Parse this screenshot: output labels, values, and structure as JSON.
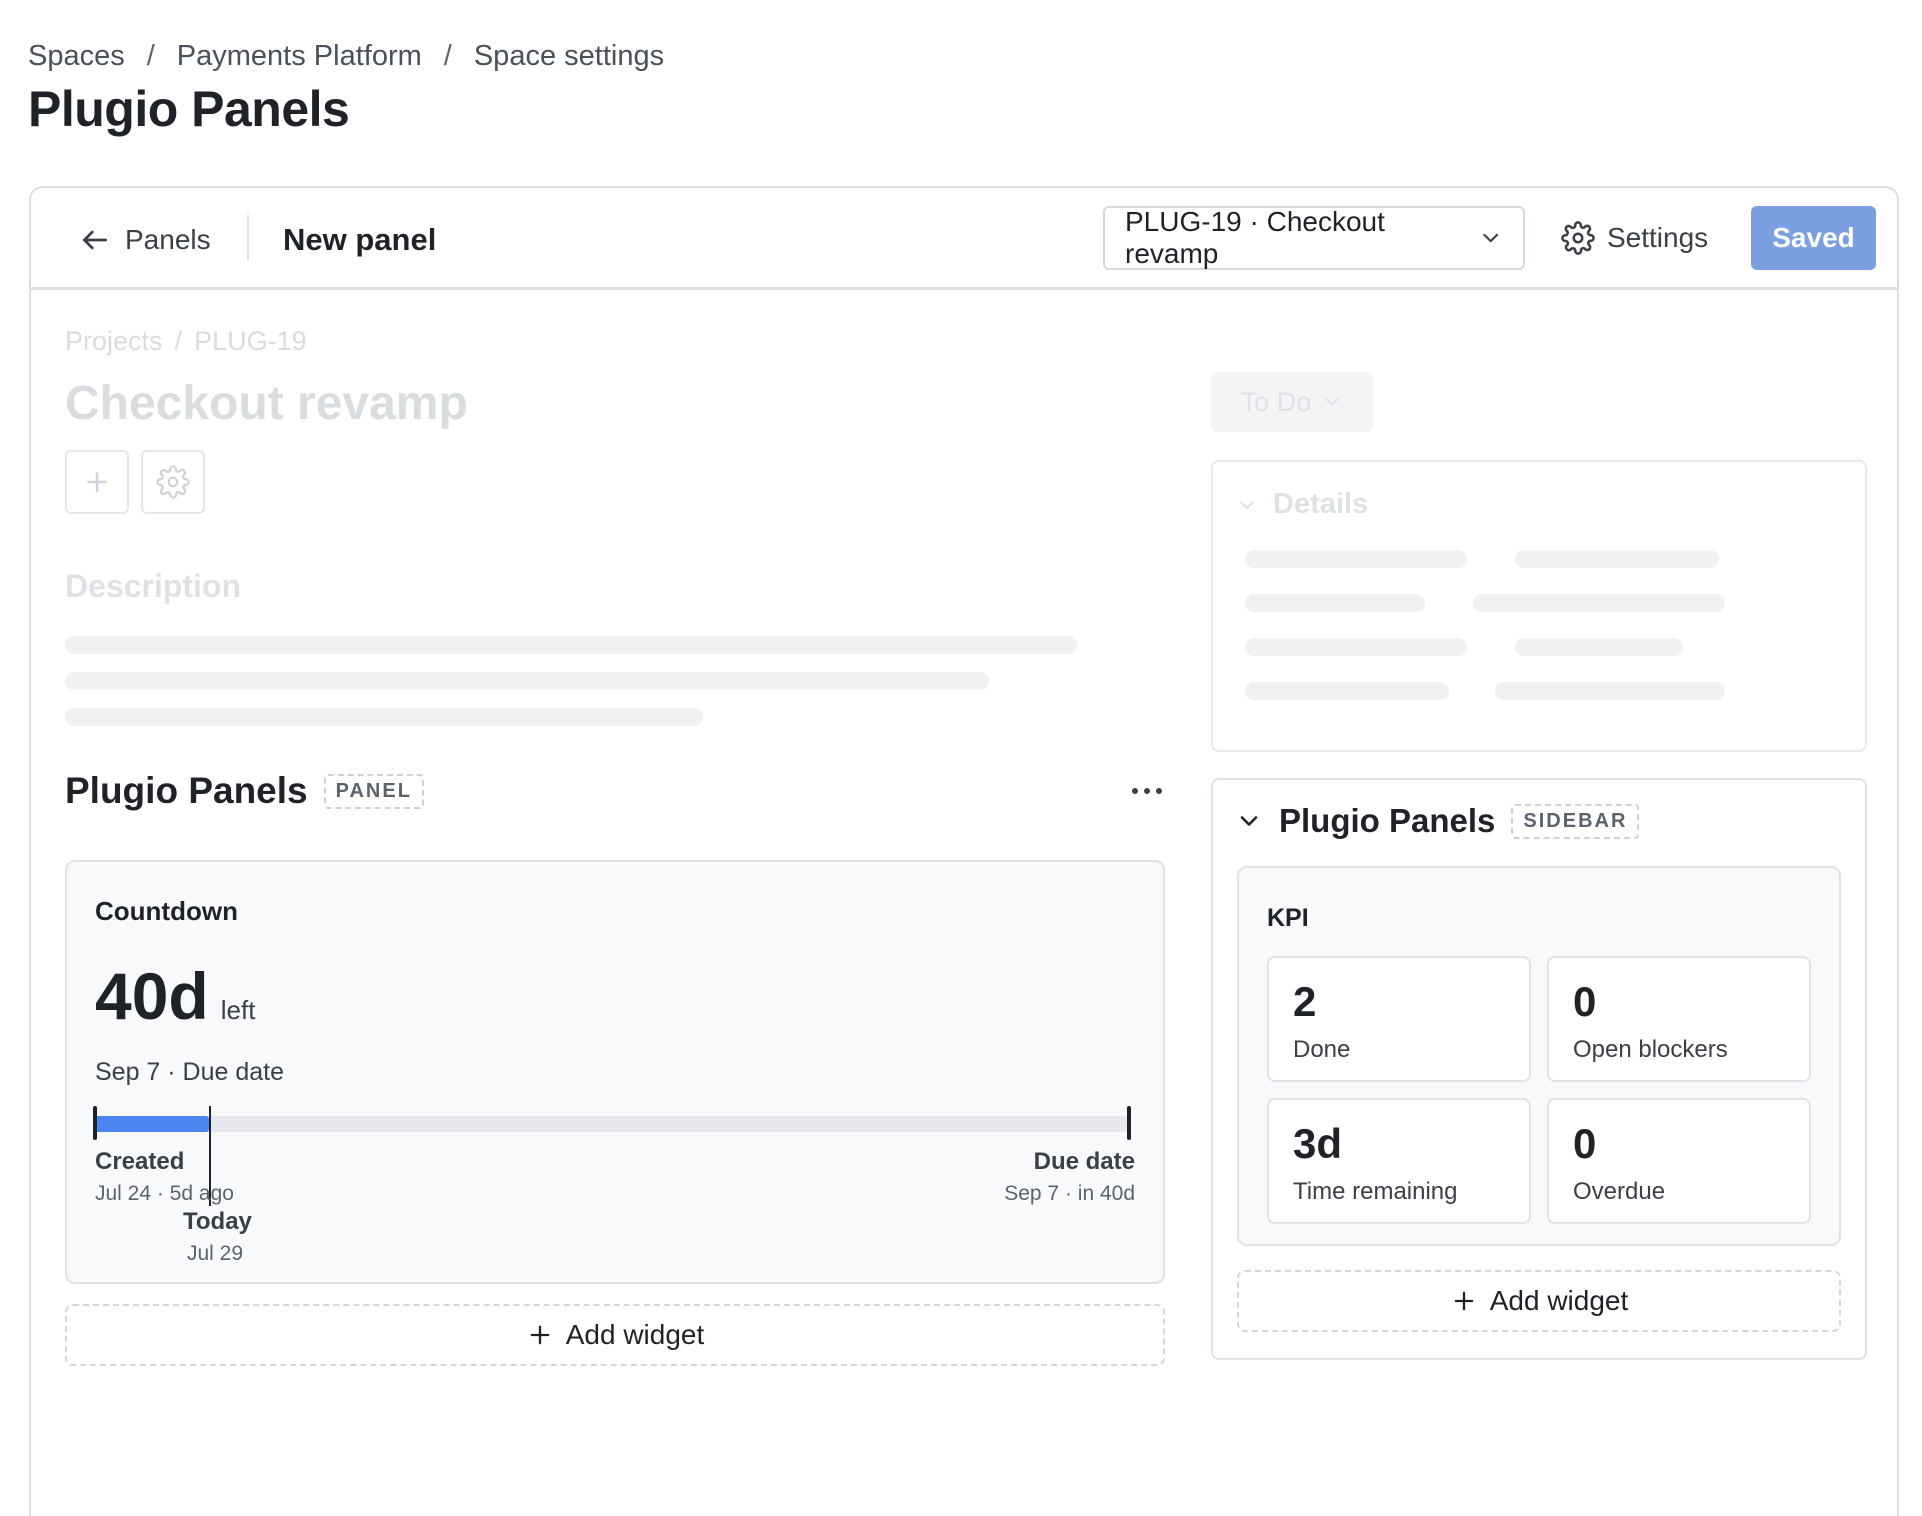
{
  "breadcrumb": [
    "Spaces",
    "Payments Platform",
    "Space settings"
  ],
  "page_title": "Plugio Panels",
  "toolbar": {
    "back_label": "Panels",
    "title": "New panel",
    "issue_select": "PLUG-19 · Checkout revamp",
    "settings_label": "Settings",
    "saved_label": "Saved"
  },
  "issue": {
    "crumb_projects": "Projects",
    "crumb_sep": "/",
    "crumb_key": "PLUG-19",
    "title": "Checkout revamp",
    "add_icon": "plus-icon",
    "gear_icon": "gear-icon",
    "description_heading": "Description",
    "status": "To Do",
    "details_heading": "Details"
  },
  "panel": {
    "name": "Plugio Panels",
    "tag": "PANEL",
    "countdown": {
      "title": "Countdown",
      "value": "40d",
      "unit": "left",
      "subtitle": "Sep 7 · Due date",
      "progress_fraction": 0.11,
      "created_label": "Created",
      "created_sub": "Jul 24 · 5d ago",
      "today_label": "Today",
      "today_sub": "Jul 29",
      "due_label": "Due date",
      "due_sub": "Sep 7 · in 40d"
    },
    "add_widget": "Add widget"
  },
  "sidebar": {
    "name": "Plugio Panels",
    "tag": "SIDEBAR",
    "kpi": {
      "title": "KPI",
      "tiles": [
        {
          "value": "2",
          "label": "Done"
        },
        {
          "value": "0",
          "label": "Open blockers"
        },
        {
          "value": "3d",
          "label": "Time remaining"
        },
        {
          "value": "0",
          "label": "Overdue"
        }
      ]
    },
    "add_widget": "Add widget"
  },
  "colors": {
    "accent": "#4a86f0",
    "saved_button": "#7b9fe0"
  }
}
